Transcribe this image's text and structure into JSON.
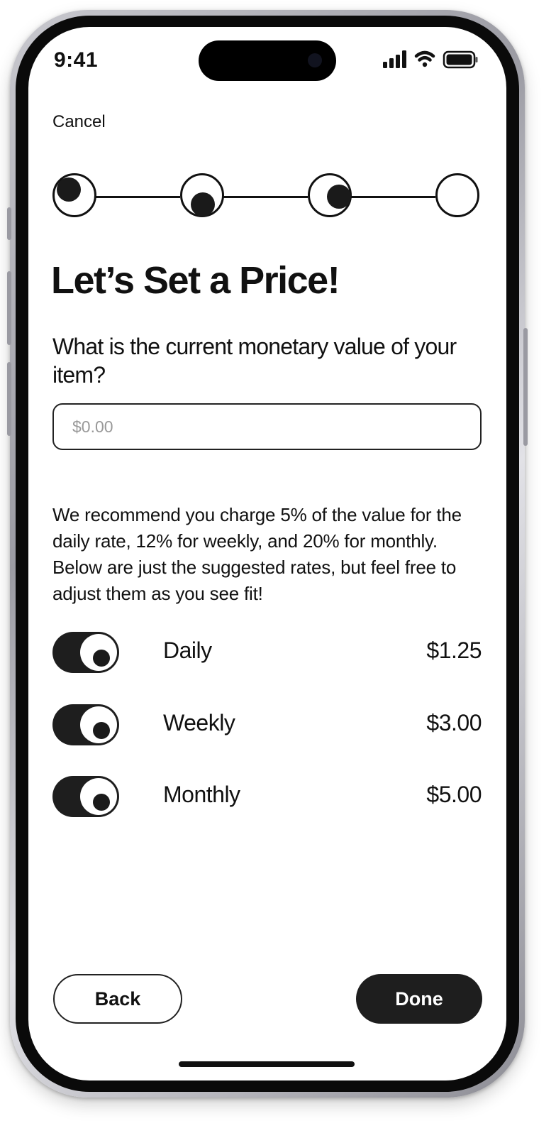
{
  "status_bar": {
    "time": "9:41",
    "signal_icon": "cellular-signal-icon",
    "wifi_icon": "wifi-icon",
    "battery_icon": "battery-icon"
  },
  "nav": {
    "cancel_label": "Cancel"
  },
  "stepper": {
    "total_steps": 4,
    "current_step": 3
  },
  "header": {
    "title": "Let’s Set a Price!"
  },
  "form": {
    "question": "What is the current monetary value of your item?",
    "price_placeholder": "$0.00",
    "price_value": ""
  },
  "recommendation": "We recommend you charge 5% of the value for the daily rate, 12% for weekly, and 20% for monthly. Below are just the suggested rates, but feel free to adjust them as you see fit!",
  "rates": [
    {
      "label": "Daily",
      "value": "$1.25",
      "enabled": true
    },
    {
      "label": "Weekly",
      "value": "$3.00",
      "enabled": true
    },
    {
      "label": "Monthly",
      "value": "$5.00",
      "enabled": true
    }
  ],
  "footer": {
    "back_label": "Back",
    "done_label": "Done"
  },
  "colors": {
    "primary": "#1e1e1e",
    "background": "#ffffff",
    "placeholder": "#999999"
  }
}
